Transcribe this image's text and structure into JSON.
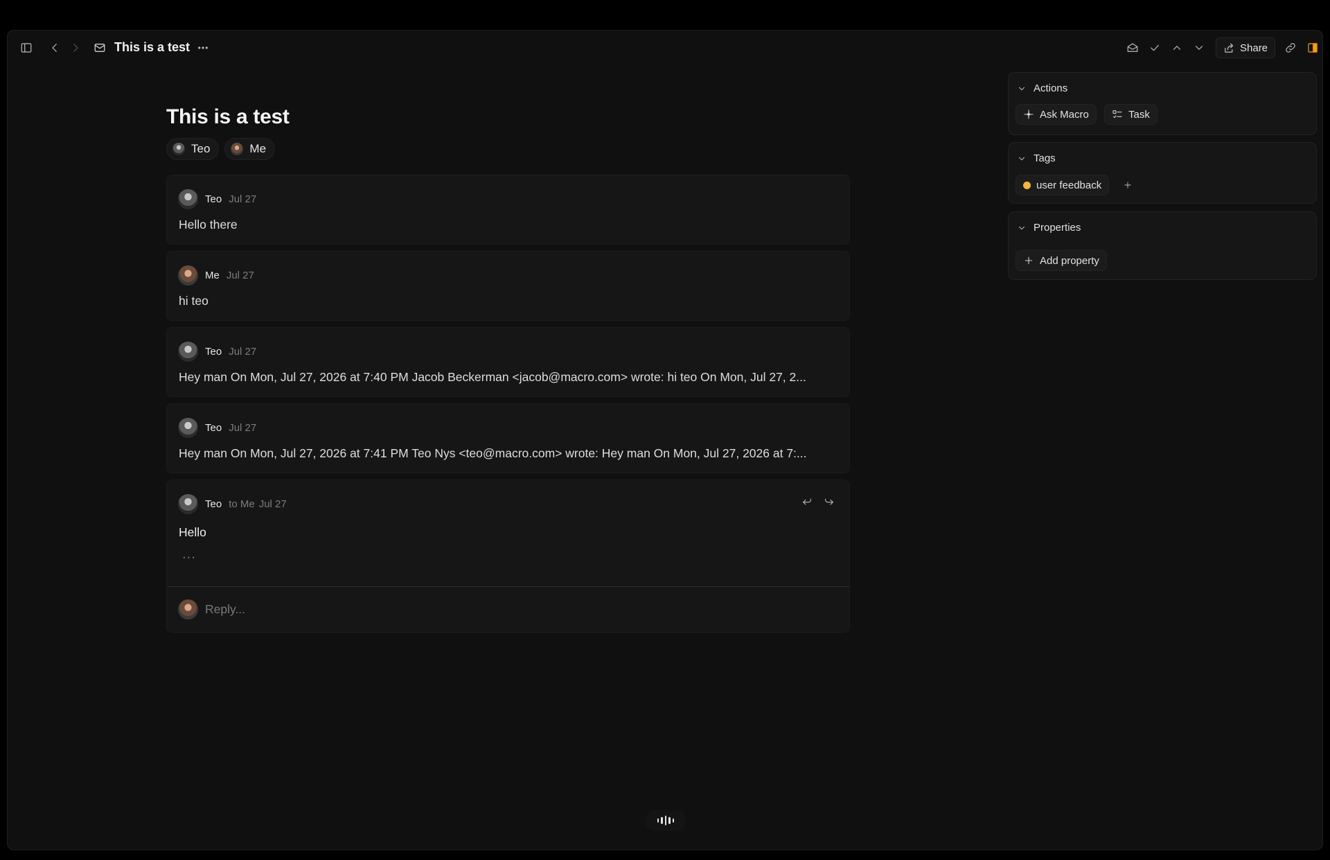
{
  "topbar": {
    "title": "This is a test",
    "share_label": "Share",
    "accent": "#f59e0b"
  },
  "thread": {
    "title": "This is a test",
    "participants": [
      {
        "name": "Teo"
      },
      {
        "name": "Me"
      }
    ],
    "messages": [
      {
        "sender": "Teo",
        "date": "Jul 27",
        "body": "Hello there"
      },
      {
        "sender": "Me",
        "date": "Jul 27",
        "body": "hi teo"
      },
      {
        "sender": "Teo",
        "date": "Jul 27",
        "body": "Hey man On Mon, Jul 27, 2026 at 7:40 PM Jacob Beckerman <jacob@macro.com> wrote: hi teo On Mon, Jul 27, 2..."
      },
      {
        "sender": "Teo",
        "date": "Jul 27",
        "body": "Hey man On Mon, Jul 27, 2026 at 7:41 PM Teo Nys <teo@macro.com> wrote: Hey man On Mon, Jul 27, 2026 at 7:..."
      },
      {
        "sender": "Teo",
        "to": "to Me",
        "date": "Jul 27",
        "body": "Hello",
        "collapsed_marker": "···"
      }
    ],
    "reply_placeholder": "Reply..."
  },
  "panel": {
    "actions": {
      "label": "Actions",
      "items": [
        {
          "label": "Ask Macro",
          "icon": "sparkle-icon"
        },
        {
          "label": "Task",
          "icon": "checklist-icon"
        }
      ]
    },
    "tags": {
      "label": "Tags",
      "items": [
        {
          "label": "user feedback",
          "color": "#f5b53f"
        }
      ]
    },
    "properties": {
      "label": "Properties",
      "add_label": "Add property"
    }
  }
}
